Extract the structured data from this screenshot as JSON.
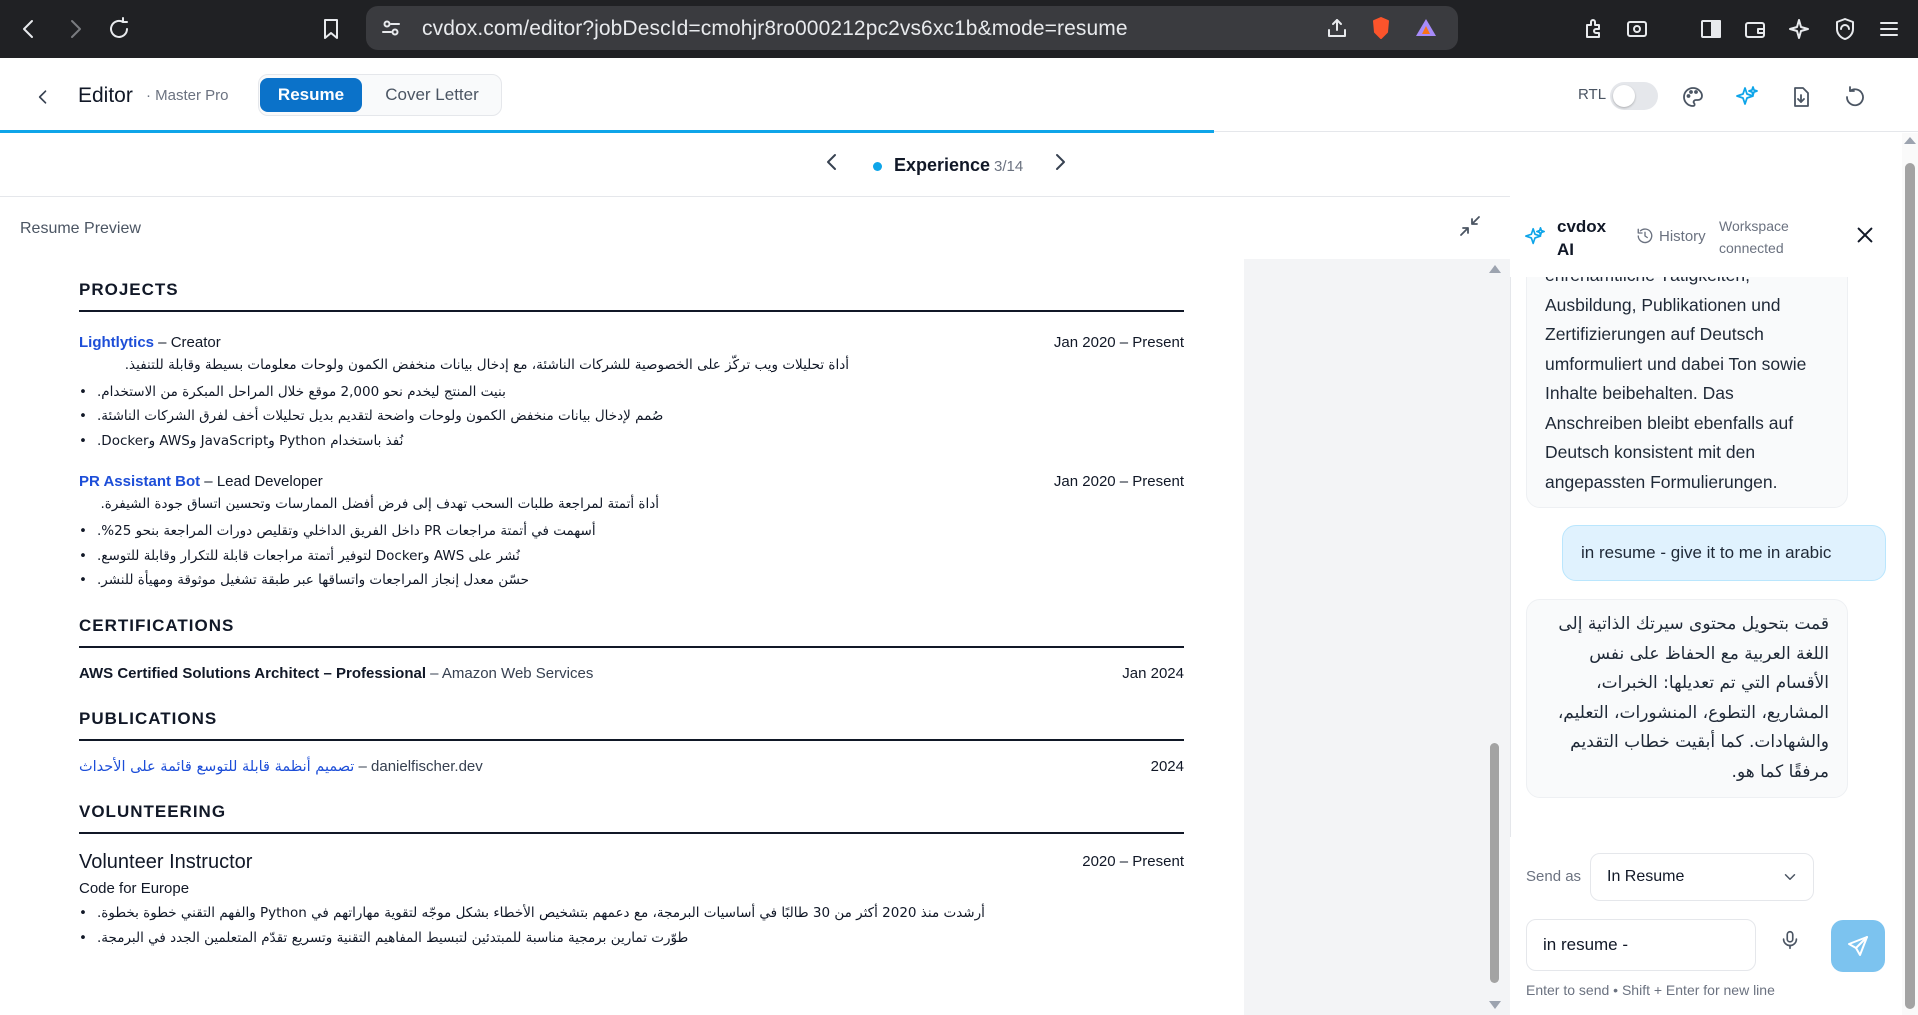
{
  "browser": {
    "url": "cvdox.com/editor?jobDescId=cmohjr8ro000212pc2vs6xc1b&mode=resume"
  },
  "header": {
    "title": "Editor",
    "template": "· Master Pro",
    "tabs": [
      "Resume",
      "Cover Letter"
    ],
    "active_tab": "Resume",
    "rtl_label": "RTL",
    "rtl_enabled": false,
    "progress_fraction": 0.633,
    "accent_color": "#0ea5e9",
    "tab_active_color": "#0b72c9"
  },
  "section_nav": {
    "name": "Experience",
    "count": "3/14"
  },
  "preview": {
    "title": "Resume Preview",
    "projects": {
      "heading": "PROJECTS",
      "items": [
        {
          "name": "Lightlytics",
          "role": " – Creator",
          "date": "Jan 2020 – Present",
          "summary": "أداة تحليلات ويب تركّز على الخصوصية للشركات الناشئة، مع إدخال بيانات منخفض الكمون ولوحات معلومات بسيطة وقابلة للتنفيذ.",
          "bullets": [
            "بنيت المنتج ليخدم نحو 2,000 موقع خلال المراحل المبكرة من الاستخدام.",
            "صُمم لإدخال بيانات منخفض الكمون ولوحات واضحة لتقديم بديل تحليلات أخف لفرق الشركات الناشئة.",
            "نُفذ باستخدام Python وJavaScript وAWS وDocker."
          ]
        },
        {
          "name": "PR Assistant Bot",
          "role": " – Lead Developer",
          "date": "Jan 2020 – Present",
          "summary": "أداة أتمتة لمراجعة طلبات السحب تهدف إلى فرض أفضل الممارسات وتحسين اتساق جودة الشيفرة.",
          "bullets": [
            "أسهمت في أتمتة مراجعات PR داخل الفريق الداخلي وتقليص دورات المراجعة بنحو 25%.",
            "نُشر على AWS وDocker لتوفير أتمتة مراجعات قابلة للتكرار وقابلة للتوسع.",
            "حسّن معدل إنجاز المراجعات واتساقها عبر طبقة تشغيل موثوقة ومهيأة للنشر."
          ]
        }
      ]
    },
    "certifications": {
      "heading": "CERTIFICATIONS",
      "name": "AWS Certified Solutions Architect – Professional",
      "issuer": " – Amazon Web Services",
      "date": "Jan 2024"
    },
    "publications": {
      "heading": "PUBLICATIONS",
      "title": "تصميم أنظمة قابلة للتوسع قائمة على الأحداث",
      "source": " – danielfischer.dev",
      "date": "2024"
    },
    "volunteering": {
      "heading": "VOLUNTEERING",
      "title": "Volunteer Instructor",
      "org": "Code for Europe",
      "date": "2020 – Present",
      "bullets": [
        "أرشدت منذ 2020 أكثر من 30 طالبًا في أساسيات البرمجة، مع دعمهم بتشخيص الأخطاء بشكل موجّه لتقوية مهاراتهم في Python والفهم التقني خطوة بخطوة.",
        "طوّرت تمارين برمجية مناسبة للمبتدئين لتبسيط المفاهيم التقنية وتسريع تقدّم المتعلمين الجدد في البرمجة."
      ]
    }
  },
  "ai": {
    "name": "cvdox AI",
    "history": "History",
    "workspace": "Workspace connected",
    "messages": [
      {
        "role": "assistant",
        "text": "ehrenamtliche Tätigkeiten, Ausbildung, Publikationen und Zertifizierungen auf Deutsch umformuliert und dabei Ton sowie Inhalte beibehalten. Das Anschreiben bleibt ebenfalls auf Deutsch konsistent mit den angepassten Formulierungen."
      },
      {
        "role": "user",
        "text": "in resume - give it to me in arabic"
      },
      {
        "role": "assistant",
        "text": "قمت بتحويل محتوى سيرتك الذاتية إلى اللغة العربية مع الحفاظ على نفس الأقسام التي تم تعديلها: الخبرات، المشاريع، التطوع، المنشورات، التعليم، والشهادات. كما أبقيت خطاب التقديم مرفقًا كما هو."
      }
    ],
    "send_as_label": "Send as",
    "send_as_value": "In Resume",
    "input_value": "in resume -",
    "hint": "Enter to send • Shift + Enter for new line"
  }
}
